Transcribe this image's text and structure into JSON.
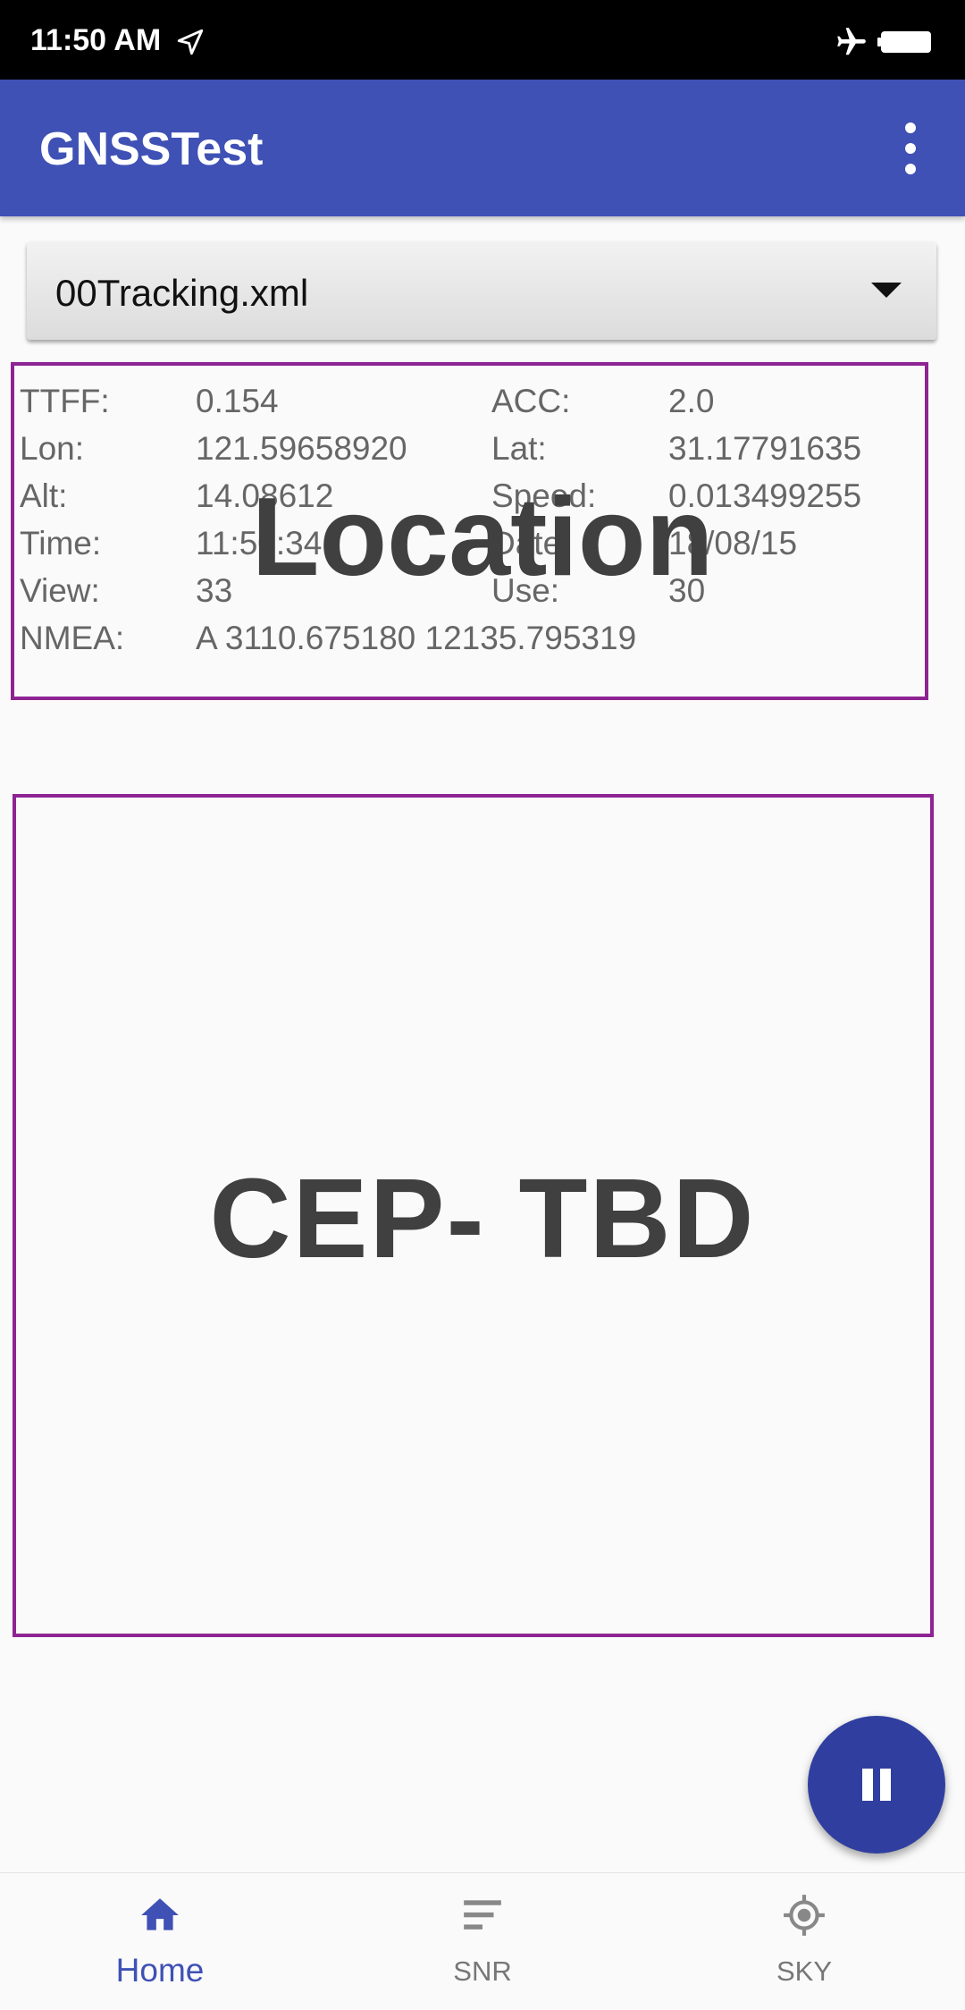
{
  "status_bar": {
    "time": "11:50 AM"
  },
  "app_bar": {
    "title": "GNSSTest"
  },
  "spinner": {
    "selected": "00Tracking.xml"
  },
  "location": {
    "ttff_label": "TTFF:",
    "ttff_value": "0.154",
    "acc_label": "ACC:",
    "acc_value": "2.0",
    "lon_label": "Lon:",
    "lon_value": "121.59658920",
    "lat_label": "Lat:",
    "lat_value": "31.17791635",
    "alt_label": "Alt:",
    "alt_value": "14.08612",
    "speed_label": "Speed:",
    "speed_value": "0.013499255",
    "time_label": "Time:",
    "time_value": "11:50:34",
    "date_label": "Date:",
    "date_value": "18/08/15",
    "view_label": "View:",
    "view_value": "33",
    "use_label": "Use:",
    "use_value": "30",
    "nmea_label": "NMEA:",
    "nmea_value": "A 3110.675180 12135.795319"
  },
  "overlays": {
    "location": "Location",
    "cep": "CEP- TBD"
  },
  "bottom_nav": {
    "items": [
      {
        "label": "Home",
        "icon": "home-icon",
        "active": true
      },
      {
        "label": "SNR",
        "icon": "snr-bars-icon",
        "active": false
      },
      {
        "label": "SKY",
        "icon": "sky-target-icon",
        "active": false
      }
    ]
  },
  "colors": {
    "primary": "#3f51b5",
    "fab": "#303f9f",
    "box_border": "#8e2493"
  }
}
